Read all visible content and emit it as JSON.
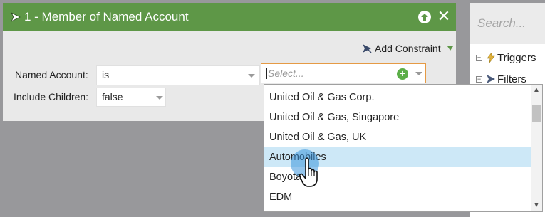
{
  "dialog": {
    "title": "1 - Member of Named Account",
    "add_constraint_label": "Add Constraint"
  },
  "form": {
    "named_account_label": "Named Account:",
    "operator_value": "is",
    "select_placeholder": "Select...",
    "include_children_label": "Include Children:",
    "include_children_value": "false"
  },
  "dropdown": {
    "items": [
      "United Oil & Gas Corp.",
      "United Oil & Gas, Singapore",
      "United Oil & Gas, UK",
      "Automobiles",
      "Boyota",
      "EDM"
    ],
    "highlighted_item": "Automobiles"
  },
  "side_panel": {
    "search_placeholder": "Search...",
    "tree_items": [
      "Triggers",
      "Filters"
    ]
  },
  "colors": {
    "titlebar": "#5e9747",
    "highlight": "#cde8f7",
    "focus_border": "#e59a45",
    "add_green": "#5bae47"
  },
  "icons": [
    "filter-icon",
    "arrow-up-icon",
    "close-icon",
    "filter-icon",
    "chevron-down-icon",
    "plus-circle-icon",
    "expand-icon",
    "trigger-icon",
    "hand-pointer-icon"
  ]
}
